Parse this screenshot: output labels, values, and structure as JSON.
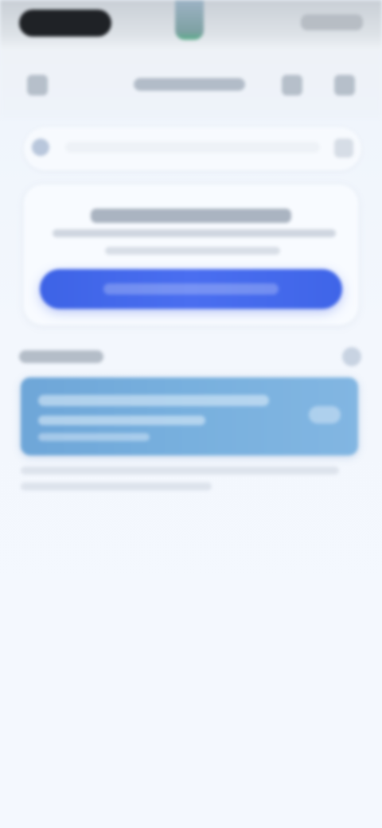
{
  "status_bar": {},
  "header": {
    "left_icon": "back-arrow-icon",
    "right_icons": [
      "share-icon",
      "more-icon"
    ]
  },
  "search": {
    "icon": "search-icon"
  },
  "card": {},
  "section": {
    "action_icon": "chevron-icon"
  },
  "highlight_item": {},
  "colors": {
    "background": "#f3f7fd",
    "primary": "#4a6ef0",
    "highlight": "#78b0de",
    "muted_text": "#b2bcc8"
  }
}
